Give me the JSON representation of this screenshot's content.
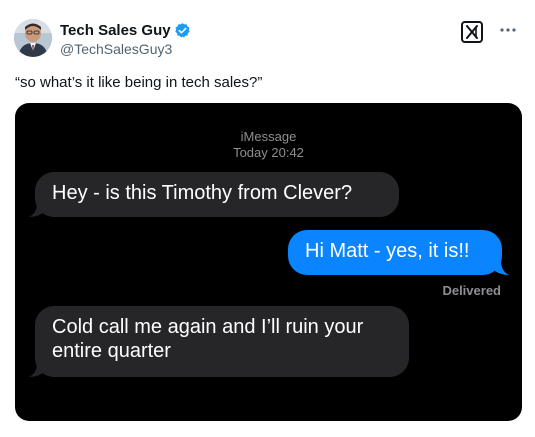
{
  "post": {
    "author": {
      "display_name": "Tech Sales Guy",
      "handle": "@TechSalesGuy3",
      "verified": true,
      "avatar": "avatar-photo"
    },
    "icons": {
      "verified": "verified-badge-icon",
      "grok": "grok-icon",
      "more": "more-options-icon"
    },
    "text": "“so what’s it like being in tech sales?”"
  },
  "imessage": {
    "service": "iMessage",
    "timestamp": "Today 20:42",
    "messages": [
      {
        "direction": "incoming",
        "text": "Hey - is this Timothy from Clever?"
      },
      {
        "direction": "outgoing",
        "text": "Hi Matt - yes, it is!!"
      },
      {
        "direction": "incoming",
        "text": "Cold call me again and I’ll ruin your entire quarter"
      }
    ],
    "status": "Delivered"
  },
  "colors": {
    "incoming_bubble": "#262629",
    "outgoing_bubble": "#0a84ff",
    "verified_blue": "#1d9bf0",
    "background": "#000000"
  }
}
